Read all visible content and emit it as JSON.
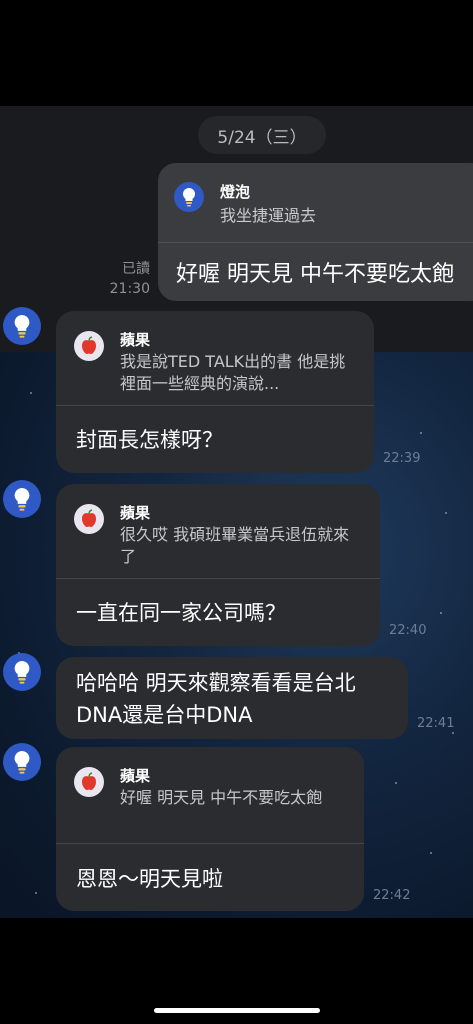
{
  "date_separator": "5/24（三）",
  "outgoing": {
    "reply_name": "燈泡",
    "reply_text": "我坐捷運過去",
    "message": "好喔 明天見 中午不要吃太飽",
    "read_label": "已讀",
    "time": "21:30"
  },
  "messages": [
    {
      "reply_name": "蘋果",
      "reply_text": "我是說TED TALK出的書 他是挑裡面一些經典的演說...",
      "message": "封面長怎樣呀？",
      "time": "22:39"
    },
    {
      "reply_name": "蘋果",
      "reply_text": "很久哎 我碩班畢業當兵退伍就來了",
      "message": "一直在同一家公司嗎？",
      "time": "22:40"
    },
    {
      "reply_name": "",
      "reply_text": "",
      "message": "哈哈哈 明天來觀察看看是台北DNA還是台中DNA",
      "time": "22:41"
    },
    {
      "reply_name": "蘋果",
      "reply_text": "好喔 明天見 中午不要吃太飽",
      "message": "恩恩～明天見啦",
      "time": "22:42"
    }
  ],
  "colors": {
    "bubble": "#2b2c30",
    "avatar_blue": "#2f59c4",
    "chat_bg": "#1a1b1e"
  },
  "icons": {
    "avatar": "lightbulb-icon",
    "reply_avatar": "apple-icon"
  }
}
